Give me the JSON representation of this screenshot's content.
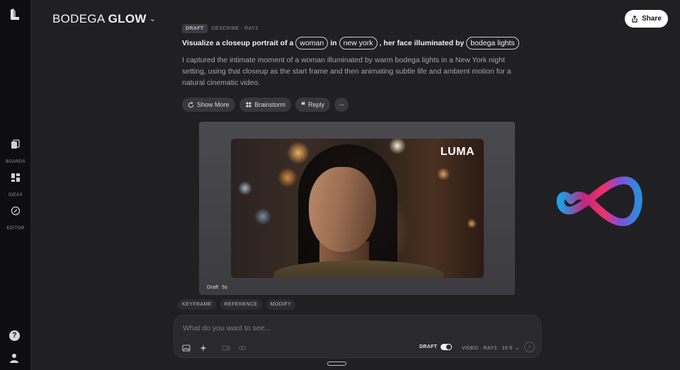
{
  "sidebar": {
    "items": [
      {
        "label": "BOARDS",
        "icon": "boards-icon"
      },
      {
        "label": "IDEAS",
        "icon": "ideas-icon"
      },
      {
        "label": "EDITOR",
        "icon": "editor-icon"
      }
    ],
    "help_glyph": "?"
  },
  "header": {
    "title_light": "BODEGA ",
    "title_bold": "GLOW",
    "share_label": "Share"
  },
  "prompt": {
    "badge": "DRAFT",
    "meta": "DESCRIBE · RAY2",
    "parts": [
      "Visualize a closeup portrait of a",
      "woman",
      "in",
      "new york",
      ", her face illuminated by",
      "bodega lights"
    ],
    "description": "I captured the intimate moment of a woman illuminated by warm bodega lights in a New York night setting, using that closeup as the start frame and then animating subtle life and ambient motion for a natural cinematic video."
  },
  "actions": {
    "show_more": "Show More",
    "brainstorm": "Brainstorm",
    "reply": "Reply",
    "more": "···"
  },
  "media": {
    "watermark": "LUMA",
    "status": "Draft",
    "duration": "5s"
  },
  "tags": [
    "KEYFRAME",
    "REFERENCE",
    "MODIFY"
  ],
  "composer": {
    "placeholder": "What do you want to see...",
    "draft_label": "DRAFT",
    "draft_on": true,
    "model": "VIDEO · RAY3 · 16:9"
  },
  "colors": {
    "background": "#202023",
    "sidebar": "#0e0e10",
    "accent_pink": "#e8306e",
    "accent_blue": "#2f8fe0"
  }
}
